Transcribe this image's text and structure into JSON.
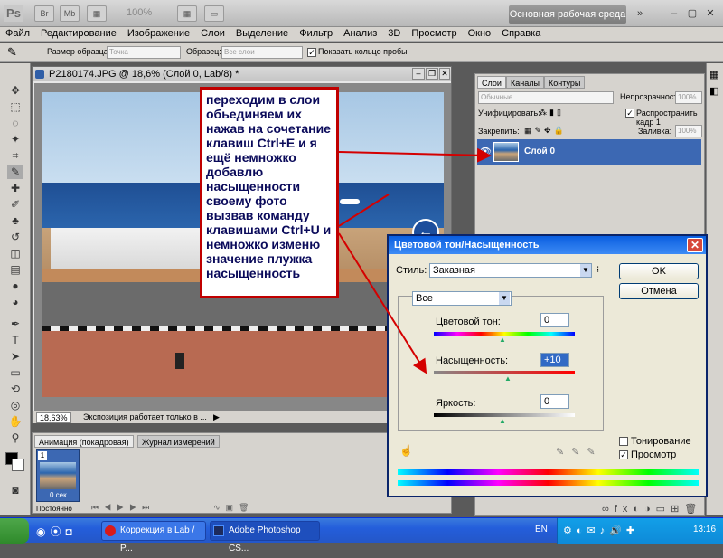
{
  "app": {
    "logo": "Ps",
    "zoom": "100%",
    "workspace": "Основная рабочая среда",
    "accent": "#3c68b3"
  },
  "menu": [
    "Файл",
    "Редактирование",
    "Изображение",
    "Слои",
    "Выделение",
    "Фильтр",
    "Анализ",
    "3D",
    "Просмотр",
    "Окно",
    "Справка"
  ],
  "options": {
    "sample_size_label": "Размер образца:",
    "sample_size_value": "Точка",
    "sample_label": "Образец:",
    "sample_value": "Все слои",
    "show_ring_label": "Показать кольцо пробы",
    "show_ring_checked": true
  },
  "document": {
    "title": "P2180174.JPG @ 18,6% (Слой 0, Lab/8) *",
    "zoom": "18,63%",
    "status": "Экспозиция работает только в ..."
  },
  "annotation": {
    "text": "переходим в слои обьединяем их нажав на сочетание клавиш Ctrl+E и я ещё немножко добавлю насыщенности своему фото вызвав команду клавишами Ctrl+U и  немножко изменю значение плужка насыщенность"
  },
  "animation": {
    "tab_active": "Анимация (покадровая)",
    "tab_inactive": "Журнал измерений",
    "frame_number": "1",
    "frame_delay": "0 сек.",
    "loop": "Постоянно"
  },
  "layers_panel": {
    "tabs": [
      "Слои",
      "Каналы",
      "Контуры"
    ],
    "blend_mode": "Обычные",
    "opacity_label": "Непрозрачность:",
    "opacity_value": "100%",
    "unify_label": "Унифицировать:",
    "propagate_label": "Распространить кадр 1",
    "lock_label": "Закрепить:",
    "fill_label": "Заливка:",
    "fill_value": "100%",
    "layer_name": "Слой 0"
  },
  "dialog": {
    "title": "Цветовой тон/Насыщенность",
    "style_label": "Стиль:",
    "style_value": "Заказная",
    "ok": "OK",
    "cancel": "Отмена",
    "range": "Все",
    "hue_label": "Цветовой тон:",
    "hue_value": "0",
    "saturation_label": "Насыщенность:",
    "saturation_value": "+10",
    "lightness_label": "Яркость:",
    "lightness_value": "0",
    "colorize_label": "Тонирование",
    "colorize_checked": false,
    "preview_label": "Просмотр",
    "preview_checked": true
  },
  "taskbar": {
    "tasks": [
      "Коррекция в Lab / P...",
      "Adobe Photoshop CS..."
    ],
    "lang": "EN",
    "clock": "13:16"
  }
}
